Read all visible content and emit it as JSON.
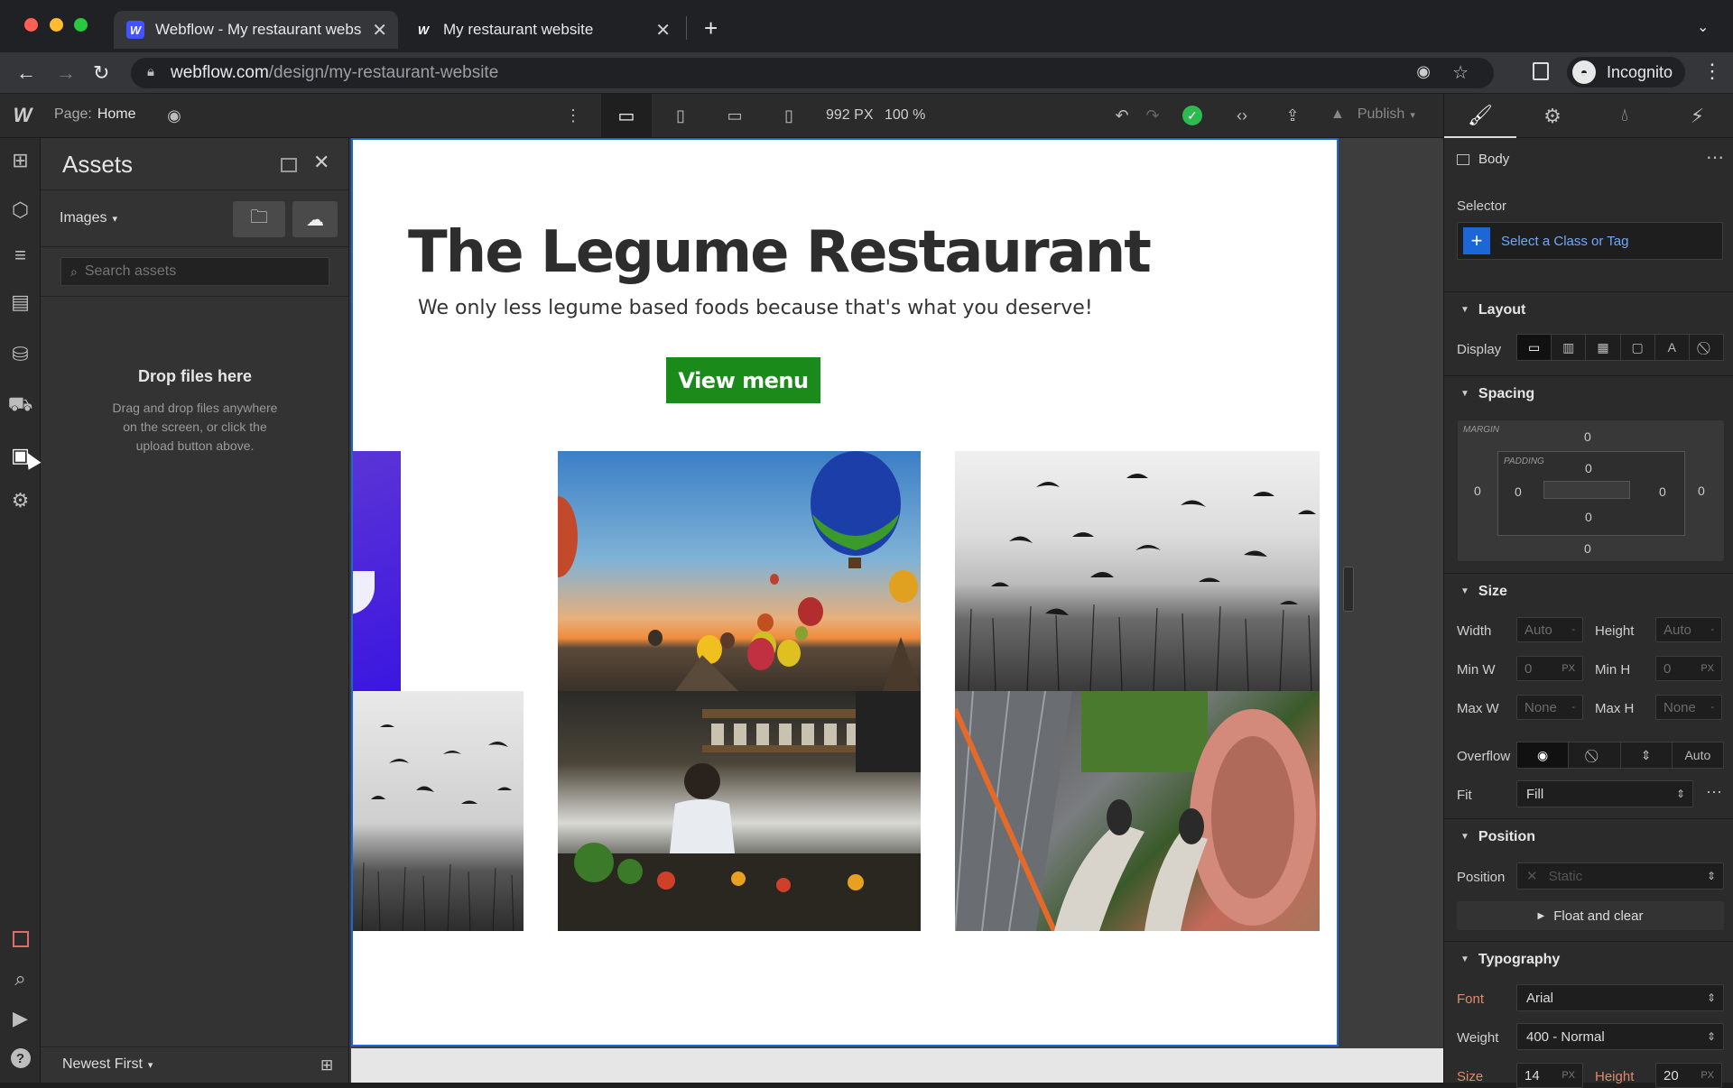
{
  "browser": {
    "tabs": [
      {
        "title": "Webflow - My restaurant webs",
        "favicon": "W"
      },
      {
        "title": "My restaurant website",
        "favicon": "W"
      }
    ],
    "url_host": "webflow.com",
    "url_path": "/design/my-restaurant-website",
    "profile": "Incognito"
  },
  "topbar": {
    "page_label": "Page:",
    "page_name": "Home",
    "width": "992 PX",
    "zoom": "100 %",
    "publish": "Publish"
  },
  "assets": {
    "title": "Assets",
    "filter": "Images",
    "search_placeholder": "Search assets",
    "drop_title": "Drop files here",
    "drop_hint_1": "Drag and drop files anywhere",
    "drop_hint_2": "on the screen, or click the",
    "drop_hint_3": "upload button above.",
    "sort": "Newest First"
  },
  "site": {
    "heading": "The Legume Restaurant",
    "subtitle": "We only less legume based foods because that's what you deserve!",
    "button": "View menu",
    "button_color": "#1a8a1a"
  },
  "style_panel": {
    "element": "Body",
    "selector_label": "Selector",
    "selector_placeholder": "Select a Class or Tag",
    "layout": {
      "title": "Layout",
      "display_label": "Display"
    },
    "spacing": {
      "title": "Spacing",
      "margin_label": "MARGIN",
      "padding_label": "PADDING",
      "margin": {
        "top": "0",
        "right": "0",
        "bottom": "0",
        "left": "0"
      },
      "padding": {
        "top": "0",
        "right": "0",
        "bottom": "0",
        "left": "0"
      }
    },
    "size": {
      "title": "Size",
      "width_label": "Width",
      "width_val": "Auto",
      "width_unit": "-",
      "height_label": "Height",
      "height_val": "Auto",
      "height_unit": "-",
      "minw_label": "Min W",
      "minw_val": "0",
      "minw_unit": "PX",
      "minh_label": "Min H",
      "minh_val": "0",
      "minh_unit": "PX",
      "maxw_label": "Max W",
      "maxw_val": "None",
      "maxw_unit": "-",
      "maxh_label": "Max H",
      "maxh_val": "None",
      "maxh_unit": "-",
      "overflow_label": "Overflow",
      "overflow_auto": "Auto",
      "fit_label": "Fit",
      "fit_val": "Fill"
    },
    "position": {
      "title": "Position",
      "position_label": "Position",
      "position_val": "Static",
      "float_clear": "Float and clear"
    },
    "typography": {
      "title": "Typography",
      "font_label": "Font",
      "font_val": "Arial",
      "weight_label": "Weight",
      "weight_val": "400 - Normal",
      "size_label": "Size",
      "size_val": "14",
      "size_unit": "PX",
      "height_label": "Height",
      "height_val": "20",
      "height_unit": "PX"
    }
  }
}
